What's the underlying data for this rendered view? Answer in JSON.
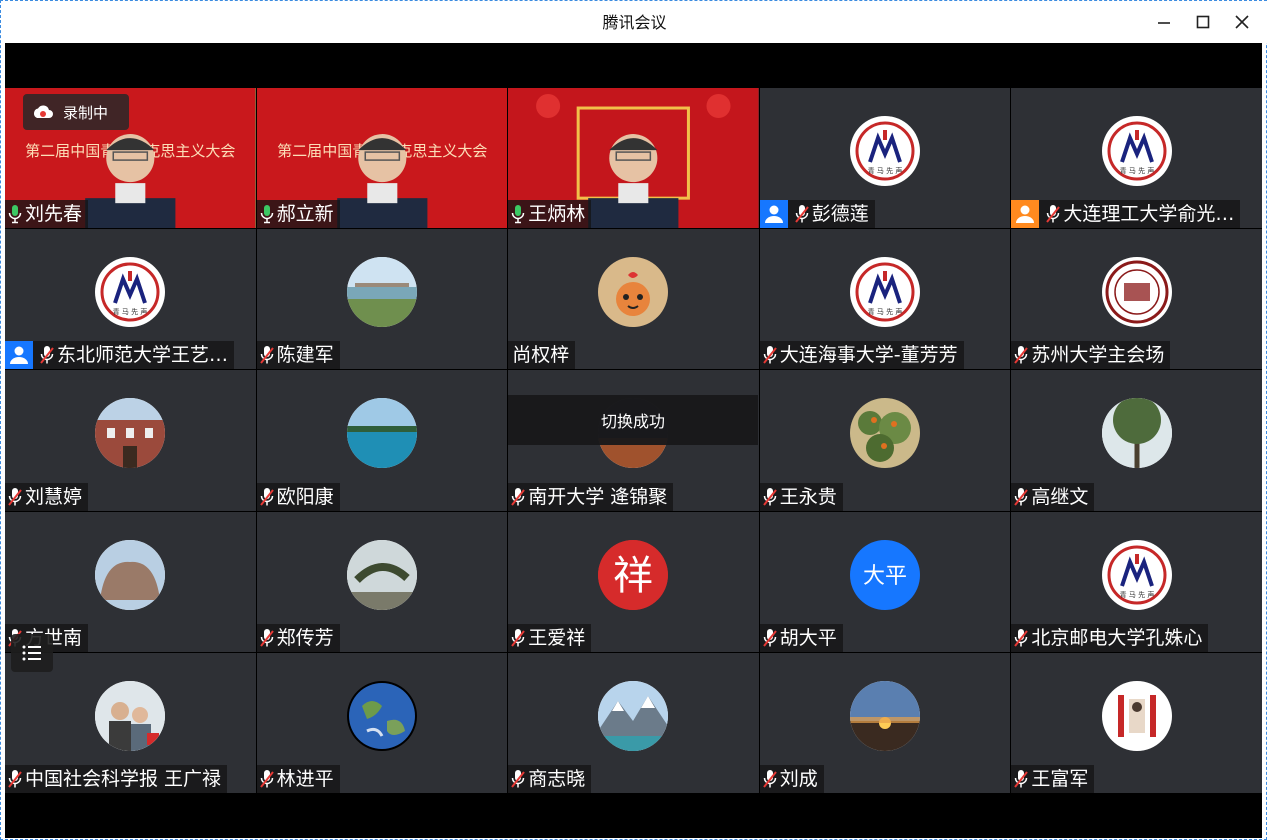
{
  "window": {
    "title": "腾讯会议"
  },
  "recording": {
    "label": "录制中"
  },
  "toast": {
    "text": "切换成功"
  },
  "colors": {
    "accent": "#1a73e8",
    "role_blue": "#1677ff",
    "role_orange": "#ff8a1f",
    "active_border": "#3cc864"
  },
  "participants": [
    {
      "name": "刘先春",
      "mic": "on",
      "video": true
    },
    {
      "name": "郝立新",
      "mic": "on",
      "video": true
    },
    {
      "name": "王炳林",
      "mic": "on",
      "video": true
    },
    {
      "name": "彭德莲",
      "mic": "muted",
      "role": "blue",
      "avatar": "qingma-logo"
    },
    {
      "name": "大连理工大学俞光…",
      "mic": "muted",
      "role": "orange",
      "avatar": "qingma-logo"
    },
    {
      "name": "东北师范大学王艺…",
      "mic": "muted",
      "role": "blue",
      "avatar": "qingma-logo"
    },
    {
      "name": "陈建军",
      "mic": "muted",
      "avatar": "river-photo"
    },
    {
      "name": "尚权梓",
      "mic": "none",
      "avatar": "tiger-cartoon"
    },
    {
      "name": "大连海事大学-董芳芳",
      "mic": "muted",
      "avatar": "qingma-logo"
    },
    {
      "name": "苏州大学主会场",
      "mic": "muted",
      "avatar": "university-seal"
    },
    {
      "name": "刘慧婷",
      "mic": "muted",
      "avatar": "building-photo"
    },
    {
      "name": "欧阳康",
      "mic": "muted",
      "avatar": "sea-photo"
    },
    {
      "name": "南开大学 逄锦聚",
      "mic": "muted",
      "avatar": "dark-photo"
    },
    {
      "name": "王永贵",
      "mic": "muted",
      "avatar": "flowers-photo"
    },
    {
      "name": "高继文",
      "mic": "muted",
      "avatar": "tree-photo"
    },
    {
      "name": "方世南",
      "mic": "muted",
      "avatar": "rock-photo"
    },
    {
      "name": "郑传芳",
      "mic": "muted",
      "avatar": "pine-photo"
    },
    {
      "name": "王爱祥",
      "mic": "muted",
      "avatar": "xiang-character"
    },
    {
      "name": "胡大平",
      "mic": "muted",
      "avatar": "text-avatar",
      "avatar_text": "大平"
    },
    {
      "name": "北京邮电大学孔姝心",
      "mic": "muted",
      "avatar": "qingma-logo"
    },
    {
      "name": "中国社会科学报 王广禄",
      "mic": "muted",
      "avatar": "family-photo"
    },
    {
      "name": "林进平",
      "mic": "muted",
      "avatar": "earth-photo"
    },
    {
      "name": "商志晓",
      "mic": "muted",
      "avatar": "mountain-photo"
    },
    {
      "name": "刘成",
      "mic": "muted",
      "avatar": "sunset-photo"
    },
    {
      "name": "王富军",
      "mic": "muted",
      "avatar": "striped-logo"
    }
  ]
}
